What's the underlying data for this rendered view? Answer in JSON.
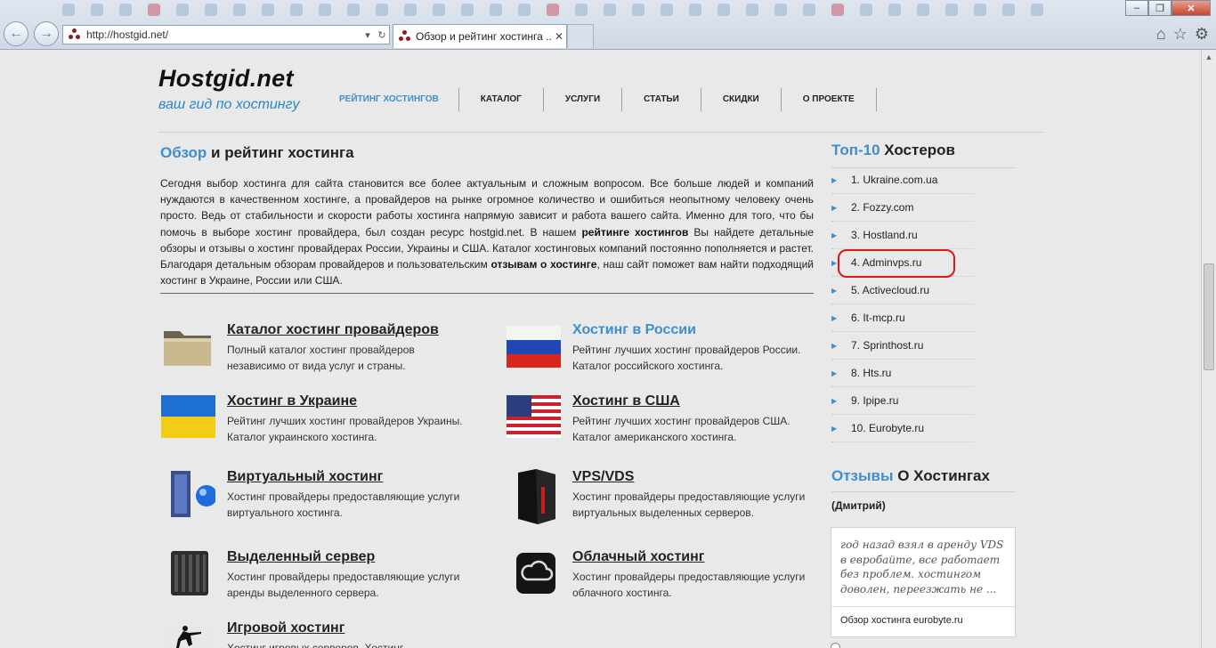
{
  "browser": {
    "url": "http://hostgid.net/",
    "tab_title": "Обзор и рейтинг хостинга ...",
    "tab_close": "✕",
    "back_icon": "arrow-left-icon",
    "forward_icon": "arrow-right-icon",
    "home_icon": "home-icon",
    "favorites_icon": "star-icon",
    "settings_icon": "gear-icon"
  },
  "header": {
    "logo_title": "Hostgid.net",
    "logo_subtitle": "ваш гид по хостингу"
  },
  "menu": [
    {
      "label": "РЕЙТИНГ ХОСТИНГОВ",
      "active": true
    },
    {
      "label": "КАТАЛОГ"
    },
    {
      "label": "УСЛУГИ"
    },
    {
      "label": "СТАТЬИ"
    },
    {
      "label": "СКИДКИ"
    },
    {
      "label": "О ПРОЕКТЕ"
    }
  ],
  "main": {
    "title_accent": "Обзор",
    "title_rest": " и рейтинг хостинга",
    "intro_parts": [
      "Сегодня выбор хостинга для сайта становится все более актуальным и сложным вопросом. Все больше людей и компаний нуждаются в качественном хостинге, а провайдеров на рынке огромное количество и ошибиться неопытному человеку очень просто. Ведь от стабильности и скорости работы хостинга напрямую зависит и работа вашего сайта. Именно для того, что бы помочь в выборе хостинг провайдера, был создан ресурс hostgid.net. В нашем ",
      "рейтинге хостингов",
      " Вы найдете детальные обзоры и отзывы о хостинг провайдерах России, Украины и США. Каталог хостинговых компаний постоянно пополняется и растет. Благодаря детальным обзорам провайдеров и пользовательским ",
      "отзывам о хостинге",
      ", наш сайт поможет вам найти подходящий хостинг в Украине, России или США."
    ],
    "categories": [
      {
        "title": "Каталог хостинг провайдеров",
        "desc": "Полный каталог хостинг провайдеров независимо от вида услуг и страны.",
        "icon": "folder-icon"
      },
      {
        "title": "Хостинг в России",
        "desc": "Рейтинг лучших хостинг провайдеров России.  Каталог российского хостинга.",
        "icon": "russia-flag-icon"
      },
      {
        "title": "Хостинг в Украине",
        "desc": "Рейтинг лучших хостинг провайдеров Украины. Каталог украинского хостинга.",
        "icon": "ukraine-flag-icon"
      },
      {
        "title": "Хостинг в США",
        "desc": "Рейтинг лучших хостинг провайдеров США. Каталог американского хостинга.",
        "icon": "usa-flag-icon"
      },
      {
        "title": "Виртуальный хостинг",
        "desc": "Хостинг провайдеры предоставляющие услуги виртуального хостинга.",
        "icon": "server-globe-icon"
      },
      {
        "title": "VPS/VDS",
        "desc": "Хостинг провайдеры предоставляющие услуги виртуальных выделенных серверов.",
        "icon": "server-tower-icon"
      },
      {
        "title": "Выделенный сервер",
        "desc": "Хостинг провайдеры предоставляющие услуги аренды выделенного сервера.",
        "icon": "server-rack-icon"
      },
      {
        "title": "Облачный хостинг",
        "desc": "Хостинг провайдеры предоставляющие услуги облачного хостинга.",
        "icon": "cloud-icon"
      },
      {
        "title": "Игровой хостинг",
        "desc": "Хостинг игровых серверов. Хостинг",
        "icon": "soldier-icon"
      }
    ]
  },
  "sidebar": {
    "top_title_accent": "Топ-10",
    "top_title_rest": " Хостеров",
    "top_items": [
      "1. Ukraine.com.ua",
      "2. Fozzy.com",
      "3. Hostland.ru",
      "4. Adminvps.ru",
      "5. Activecloud.ru",
      "6. It-mcp.ru",
      "7. Sprinthost.ru",
      "8. Hts.ru",
      "9. Ipipe.ru",
      "10. Eurobyte.ru"
    ],
    "highlighted_item": "4. Adminvps.ru",
    "reviews_title_accent": "Отзывы",
    "reviews_title_rest": " О Хостингах",
    "reviewer": "(Дмитрий)",
    "review_text": "год назад взял в аренду VDS в евробайте, все работает без проблем. хостингом доволен, переезжать не ...",
    "review_link": "Обзор хостинга eurobyte.ru"
  }
}
